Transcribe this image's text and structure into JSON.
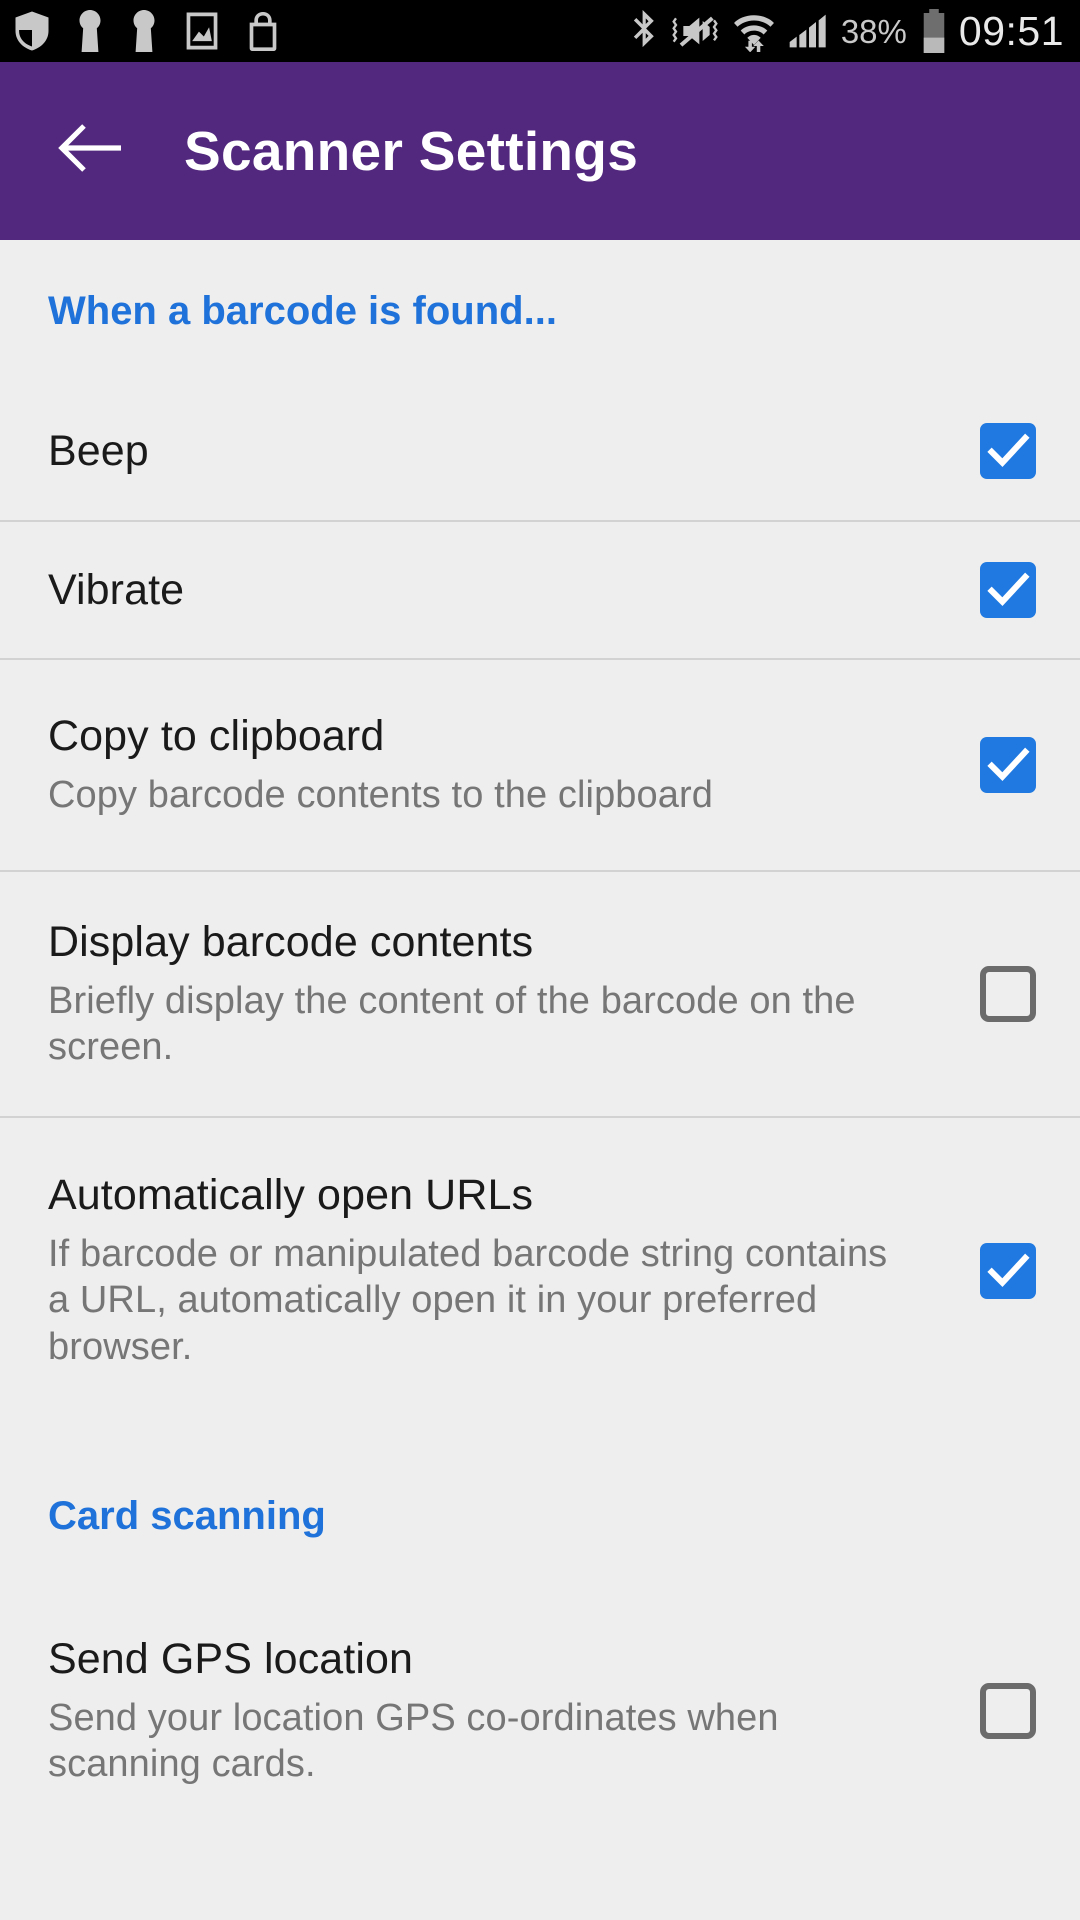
{
  "status_bar": {
    "left_icons": [
      "shield-icon",
      "key-icon",
      "key-icon",
      "screenshot-icon",
      "shopping-bag-icon"
    ],
    "right_icons": [
      "bluetooth-icon",
      "vibrate-muted-icon",
      "wifi-icon",
      "cellular-signal-icon",
      "battery-icon"
    ],
    "battery_percent": "38%",
    "time": "09:51"
  },
  "app_bar": {
    "back_label": "back-arrow",
    "title": "Scanner Settings"
  },
  "colors": {
    "app_bar": "#52287e",
    "accent_blue": "#1f72d9",
    "checkbox_checked": "#1f79e0",
    "checkbox_unchecked_border": "#6b6b6b",
    "background": "#eeeeee",
    "divider": "#d2d2d2",
    "title_text": "#1a1a1a",
    "subtitle_text": "#767676"
  },
  "sections": [
    {
      "header": "When a barcode is found...",
      "items": [
        {
          "title": "Beep",
          "subtitle": "",
          "checked": true
        },
        {
          "title": "Vibrate",
          "subtitle": "",
          "checked": true
        },
        {
          "title": "Copy to clipboard",
          "subtitle": "Copy barcode contents to the clipboard",
          "checked": true
        },
        {
          "title": "Display barcode contents",
          "subtitle": "Briefly display the content of the barcode on the screen.",
          "checked": false
        },
        {
          "title": "Automatically open URLs",
          "subtitle": "If barcode or manipulated barcode string contains a URL, automatically open it in your preferred browser.",
          "checked": true
        }
      ]
    },
    {
      "header": "Card scanning",
      "items": [
        {
          "title": "Send GPS location",
          "subtitle": "Send your location GPS co-ordinates when scanning cards.",
          "checked": false
        }
      ]
    }
  ]
}
